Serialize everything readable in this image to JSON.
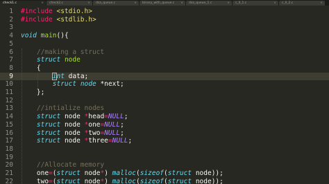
{
  "tabs": [
    {
      "label": "check1.c",
      "close": "×",
      "active": true
    },
    {
      "label": "check2.c",
      "close": "×",
      "active": false
    },
    {
      "label": "dsa_queue.c",
      "close": "×",
      "active": false
    },
    {
      "label": "binary_with_queue.c",
      "close": "×",
      "active": false
    },
    {
      "label": "dsa_queue_1.c",
      "close": "×",
      "active": false
    },
    {
      "label": "c_ll_1.c",
      "close": "×",
      "active": false
    },
    {
      "label": "c_ll_2.c",
      "close": "×",
      "active": false
    }
  ],
  "editor": {
    "current_line": 9,
    "lines": [
      {
        "n": "1",
        "tokens": [
          {
            "t": "#include ",
            "c": "pre"
          },
          {
            "t": "<stdio.h>",
            "c": "inc"
          }
        ]
      },
      {
        "n": "2",
        "tokens": [
          {
            "t": "#include ",
            "c": "pre"
          },
          {
            "t": "<stdlib.h>",
            "c": "inc"
          }
        ]
      },
      {
        "n": "3",
        "tokens": []
      },
      {
        "n": "4",
        "tokens": [
          {
            "t": "void",
            "c": "type"
          },
          {
            "t": " ",
            "c": "plain"
          },
          {
            "t": "main",
            "c": "name"
          },
          {
            "t": "(){",
            "c": "plain"
          }
        ]
      },
      {
        "n": "5",
        "tokens": []
      },
      {
        "n": "6",
        "tokens": [
          {
            "t": "    ",
            "c": "plain"
          },
          {
            "t": "//making a struct",
            "c": "com"
          }
        ]
      },
      {
        "n": "7",
        "tokens": [
          {
            "t": "    ",
            "c": "plain"
          },
          {
            "t": "struct",
            "c": "type"
          },
          {
            "t": " ",
            "c": "plain"
          },
          {
            "t": "node",
            "c": "name"
          }
        ]
      },
      {
        "n": "8",
        "tokens": [
          {
            "t": "    {",
            "c": "plain"
          }
        ]
      },
      {
        "n": "9",
        "tokens": [
          {
            "t": "        ",
            "c": "plain"
          },
          {
            "t": "int",
            "c": "type"
          },
          {
            "t": " data;",
            "c": "plain"
          }
        ]
      },
      {
        "n": "10",
        "tokens": [
          {
            "t": "        ",
            "c": "plain"
          },
          {
            "t": "struct",
            "c": "type"
          },
          {
            "t": " ",
            "c": "plain"
          },
          {
            "t": "node",
            "c": "type"
          },
          {
            "t": " *next;",
            "c": "plain"
          }
        ]
      },
      {
        "n": "11",
        "tokens": [
          {
            "t": "    };",
            "c": "plain"
          }
        ]
      },
      {
        "n": "12",
        "tokens": []
      },
      {
        "n": "13",
        "tokens": [
          {
            "t": "    ",
            "c": "plain"
          },
          {
            "t": "//intialize nodes",
            "c": "com"
          }
        ]
      },
      {
        "n": "14",
        "tokens": [
          {
            "t": "    ",
            "c": "plain"
          },
          {
            "t": "struct",
            "c": "type"
          },
          {
            "t": " node ",
            "c": "plain"
          },
          {
            "t": "*",
            "c": "op"
          },
          {
            "t": "head",
            "c": "plain"
          },
          {
            "t": "=",
            "c": "op"
          },
          {
            "t": "NULL",
            "c": "const"
          },
          {
            "t": ";",
            "c": "plain"
          }
        ]
      },
      {
        "n": "15",
        "tokens": [
          {
            "t": "    ",
            "c": "plain"
          },
          {
            "t": "struct",
            "c": "type"
          },
          {
            "t": " node ",
            "c": "plain"
          },
          {
            "t": "*",
            "c": "op"
          },
          {
            "t": "one",
            "c": "plain"
          },
          {
            "t": "=",
            "c": "op"
          },
          {
            "t": "NULL",
            "c": "const"
          },
          {
            "t": ";",
            "c": "plain"
          }
        ]
      },
      {
        "n": "16",
        "tokens": [
          {
            "t": "    ",
            "c": "plain"
          },
          {
            "t": "struct",
            "c": "type"
          },
          {
            "t": " node ",
            "c": "plain"
          },
          {
            "t": "*",
            "c": "op"
          },
          {
            "t": "two",
            "c": "plain"
          },
          {
            "t": "=",
            "c": "op"
          },
          {
            "t": "NULL",
            "c": "const"
          },
          {
            "t": ";",
            "c": "plain"
          }
        ]
      },
      {
        "n": "17",
        "tokens": [
          {
            "t": "    ",
            "c": "plain"
          },
          {
            "t": "struct",
            "c": "type"
          },
          {
            "t": " node ",
            "c": "plain"
          },
          {
            "t": "*",
            "c": "op"
          },
          {
            "t": "three",
            "c": "plain"
          },
          {
            "t": "=",
            "c": "op"
          },
          {
            "t": "NULL",
            "c": "const"
          },
          {
            "t": ";",
            "c": "plain"
          }
        ]
      },
      {
        "n": "18",
        "tokens": []
      },
      {
        "n": "19",
        "tokens": []
      },
      {
        "n": "20",
        "tokens": [
          {
            "t": "    ",
            "c": "plain"
          },
          {
            "t": "//Allocate memory",
            "c": "com"
          }
        ]
      },
      {
        "n": "21",
        "tokens": [
          {
            "t": "    one",
            "c": "plain"
          },
          {
            "t": "=",
            "c": "op"
          },
          {
            "t": "(",
            "c": "plain"
          },
          {
            "t": "struct",
            "c": "type"
          },
          {
            "t": " node",
            "c": "plain"
          },
          {
            "t": "*",
            "c": "op"
          },
          {
            "t": ") ",
            "c": "plain"
          },
          {
            "t": "malloc",
            "c": "call"
          },
          {
            "t": "(",
            "c": "plain"
          },
          {
            "t": "sizeof",
            "c": "call"
          },
          {
            "t": "(",
            "c": "plain"
          },
          {
            "t": "struct",
            "c": "type"
          },
          {
            "t": " node));",
            "c": "plain"
          }
        ]
      },
      {
        "n": "22",
        "tokens": [
          {
            "t": "    two",
            "c": "plain"
          },
          {
            "t": "=",
            "c": "op"
          },
          {
            "t": "(",
            "c": "plain"
          },
          {
            "t": "struct",
            "c": "type"
          },
          {
            "t": " node",
            "c": "plain"
          },
          {
            "t": "*",
            "c": "op"
          },
          {
            "t": ") ",
            "c": "plain"
          },
          {
            "t": "malloc",
            "c": "call"
          },
          {
            "t": "(",
            "c": "plain"
          },
          {
            "t": "sizeof",
            "c": "call"
          },
          {
            "t": "(",
            "c": "plain"
          },
          {
            "t": "struct",
            "c": "type"
          },
          {
            "t": " node));",
            "c": "plain"
          }
        ]
      }
    ]
  }
}
